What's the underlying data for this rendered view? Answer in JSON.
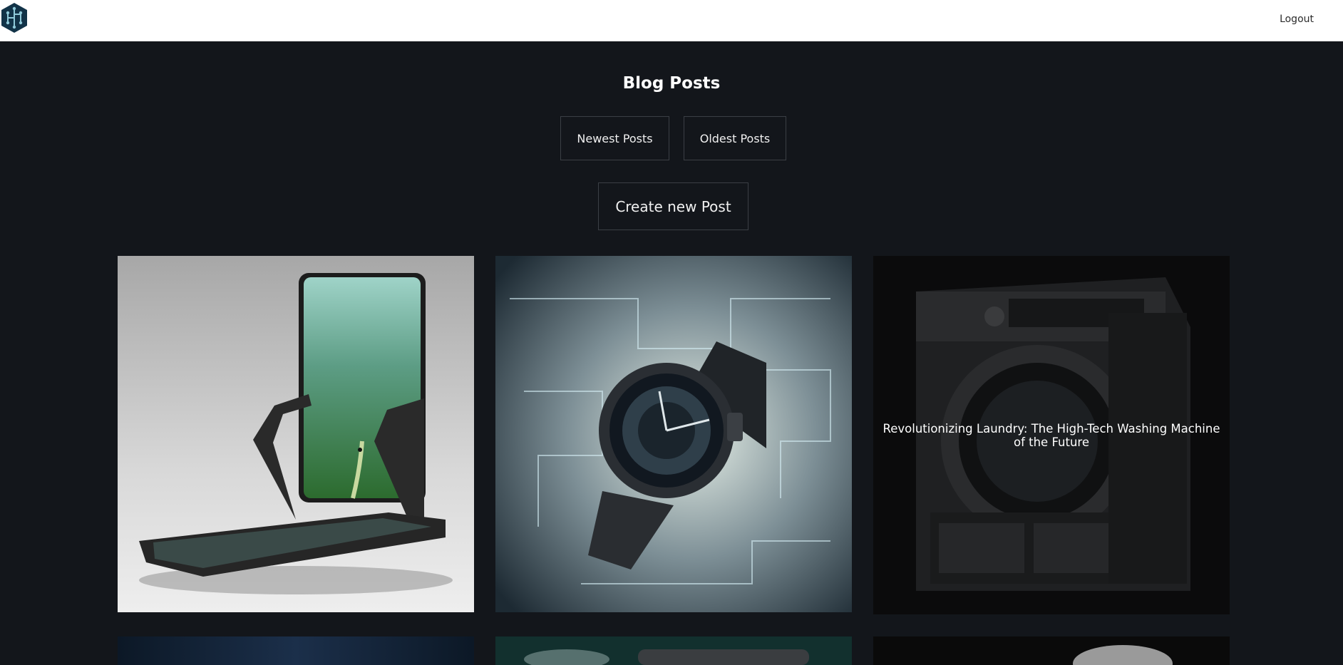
{
  "header": {
    "logo_icon": "hexagon-circuit-logo-icon",
    "logout_label": "Logout"
  },
  "page": {
    "title": "Blog Posts"
  },
  "sort": {
    "newest_label": "Newest Posts",
    "oldest_label": "Oldest Posts"
  },
  "actions": {
    "create_label": "Create new Post"
  },
  "posts": [
    {
      "title": "",
      "image": "folding-treadmill-with-forest-screen"
    },
    {
      "title": "",
      "image": "futuristic-smartwatch-circuit-background"
    },
    {
      "title": "Revolutionizing Laundry: The High-Tech Washing Machine of the Future",
      "image": "dark-high-tech-washing-machine"
    },
    {
      "title": "",
      "image": "dark-blue-gradient"
    },
    {
      "title": "",
      "image": "teal-device"
    },
    {
      "title": "",
      "image": "gray-fluffy-object"
    }
  ],
  "colors": {
    "background": "#13161b",
    "header_bg": "#ffffff",
    "button_border": "#3b3f45",
    "text": "#ffffff"
  }
}
